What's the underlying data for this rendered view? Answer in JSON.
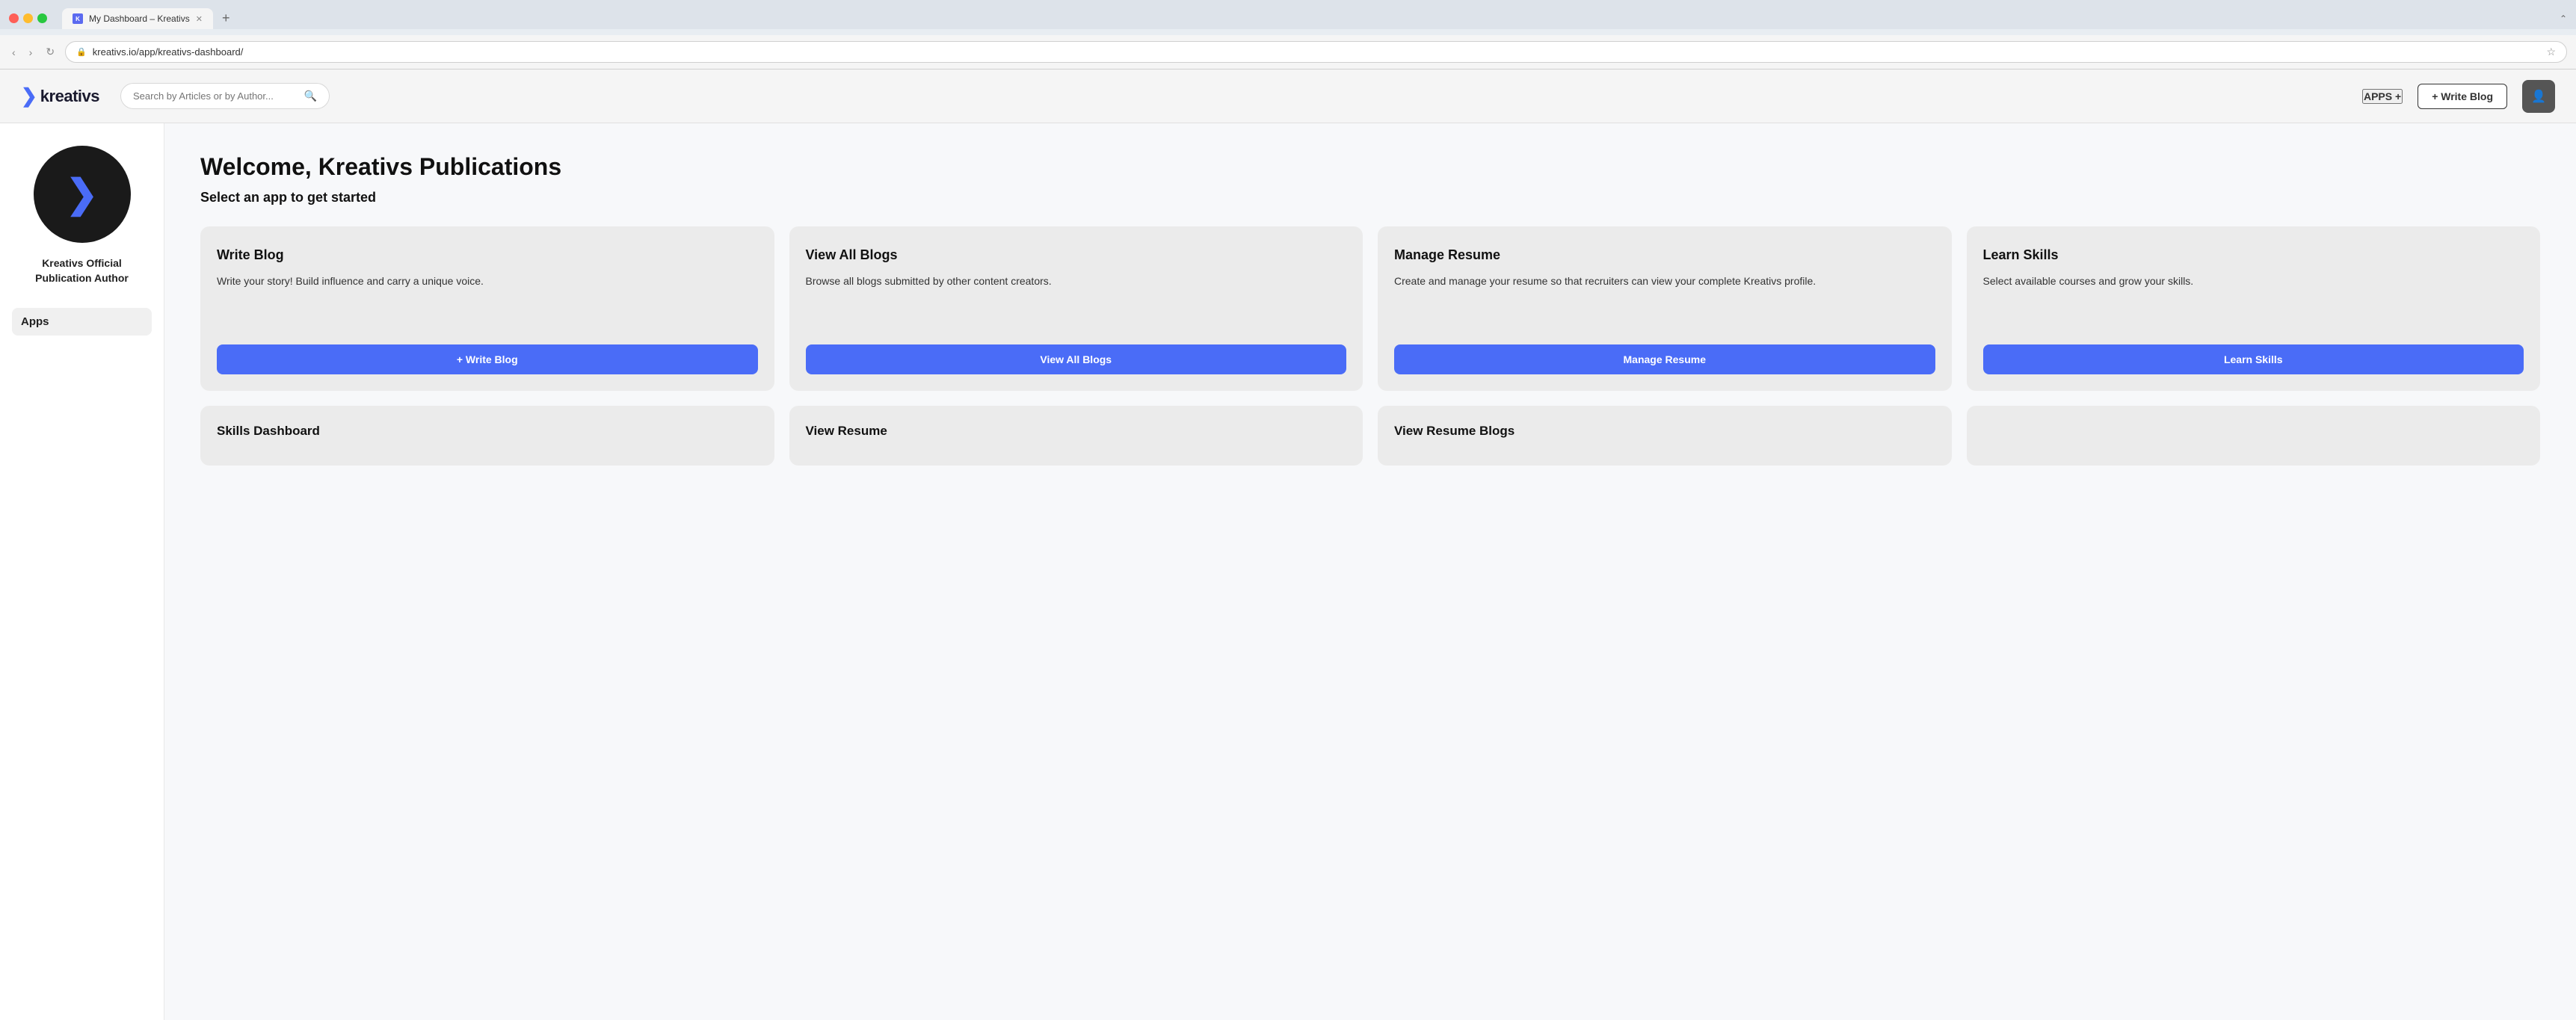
{
  "browser": {
    "traffic_lights": [
      "red",
      "yellow",
      "green"
    ],
    "tab_label": "My Dashboard – Kreativs",
    "tab_close": "✕",
    "tab_new": "+",
    "expand_icon": "⌃",
    "nav_back": "‹",
    "nav_forward": "›",
    "nav_refresh": "↻",
    "address_icon": "🔒",
    "address_url": "kreativs.io/app/kreativs-dashboard/",
    "star_icon": "☆"
  },
  "header": {
    "logo_chevron": "❯",
    "logo_text": "kreativs",
    "search_placeholder": "Search by Articles or by Author...",
    "search_icon": "🔍",
    "apps_label": "APPS +",
    "write_blog_label": "+ Write Blog",
    "avatar_icon": "👤"
  },
  "sidebar": {
    "user_name": "Kreativs Official Publication Author",
    "section_label": "Apps"
  },
  "content": {
    "welcome_title": "Welcome, Kreativs Publications",
    "select_subtitle": "Select an app to get started",
    "cards": [
      {
        "id": "write-blog",
        "title": "Write Blog",
        "desc": "Write your story! Build influence and carry a unique voice.",
        "button_label": "+ Write Blog"
      },
      {
        "id": "view-all-blogs",
        "title": "View All Blogs",
        "desc": "Browse all blogs submitted by other content creators.",
        "button_label": "View All Blogs"
      },
      {
        "id": "manage-resume",
        "title": "Manage Resume",
        "desc": "Create and manage your resume so that recruiters can view your complete Kreativs profile.",
        "button_label": "Manage Resume"
      },
      {
        "id": "learn-skills",
        "title": "Learn Skills",
        "desc": "Select available courses and grow your skills.",
        "button_label": "Learn Skills"
      }
    ],
    "bottom_cards": [
      {
        "id": "skills-dashboard",
        "title": "Skills Dashboard"
      },
      {
        "id": "view-resume",
        "title": "View Resume"
      },
      {
        "id": "view-resume-blogs",
        "title": "View Resume Blogs"
      },
      {
        "id": "placeholder4",
        "title": ""
      }
    ]
  }
}
